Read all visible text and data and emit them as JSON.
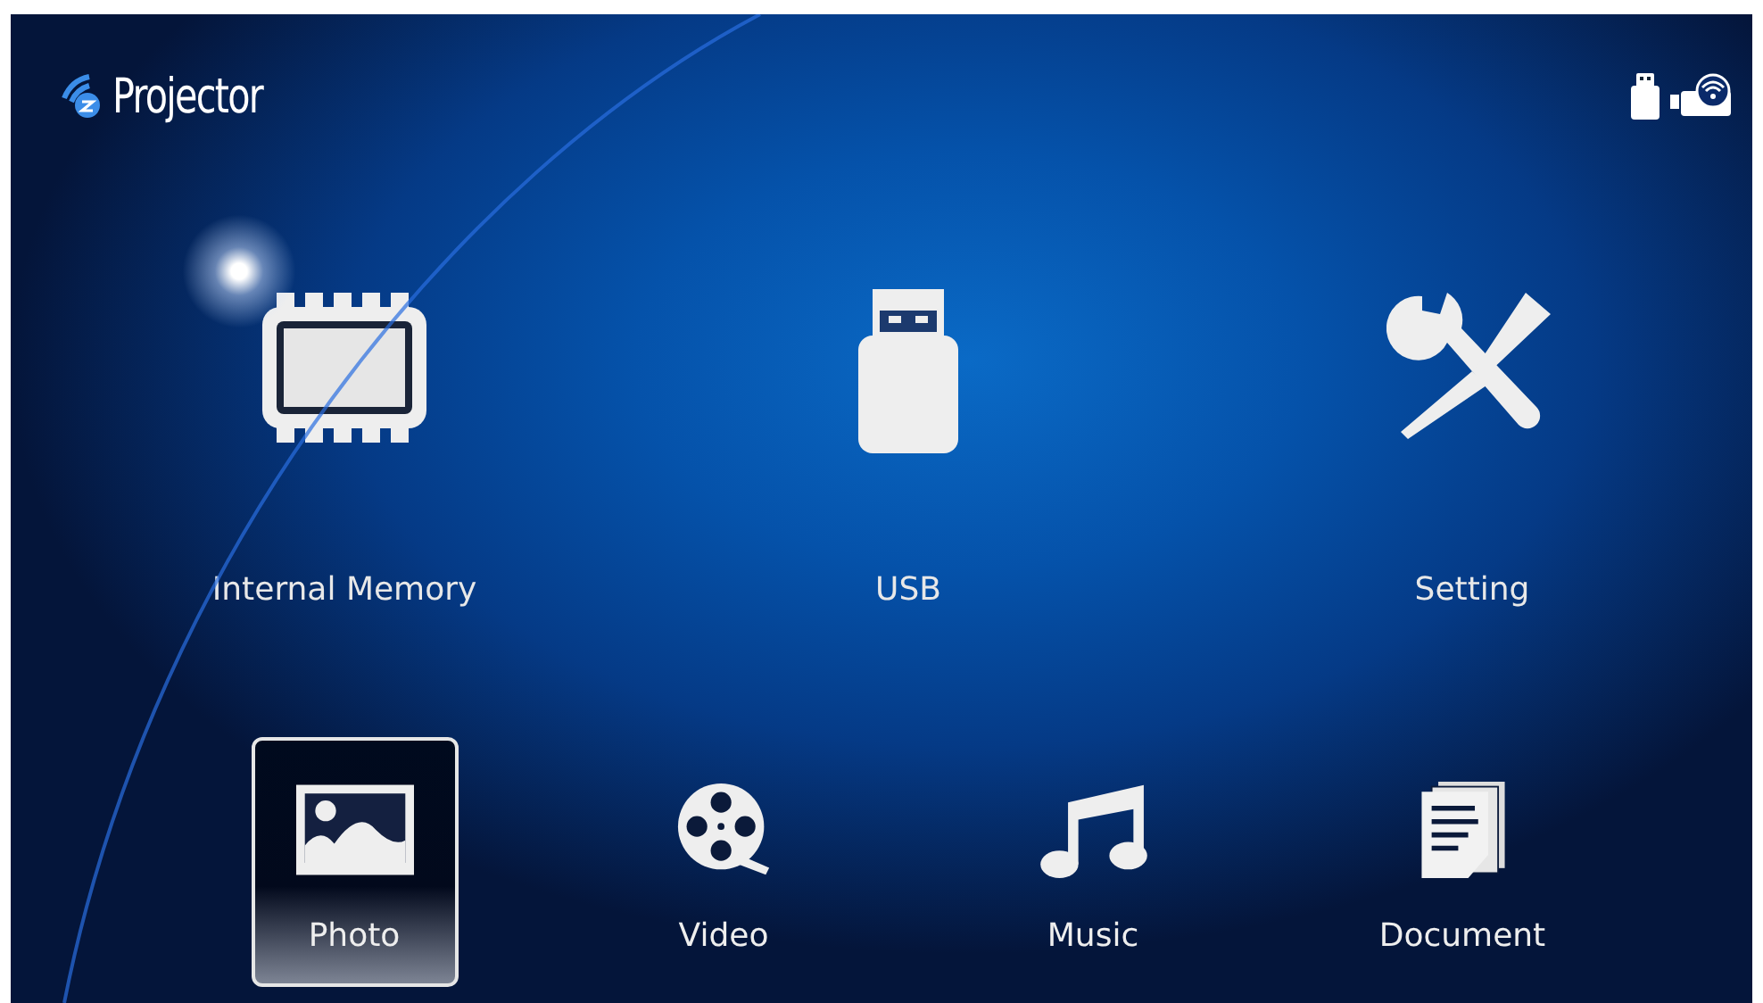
{
  "header": {
    "logo_text": "Projector"
  },
  "sources": [
    {
      "kind": "memory",
      "label": "Internal Memory"
    },
    {
      "kind": "usb",
      "label": "USB"
    },
    {
      "kind": "setting",
      "label": "Setting"
    }
  ],
  "media": [
    {
      "kind": "photo",
      "label": "Photo",
      "selected": true
    },
    {
      "kind": "video",
      "label": "Video",
      "selected": false
    },
    {
      "kind": "music",
      "label": "Music",
      "selected": false
    },
    {
      "kind": "document",
      "label": "Document",
      "selected": false
    }
  ]
}
